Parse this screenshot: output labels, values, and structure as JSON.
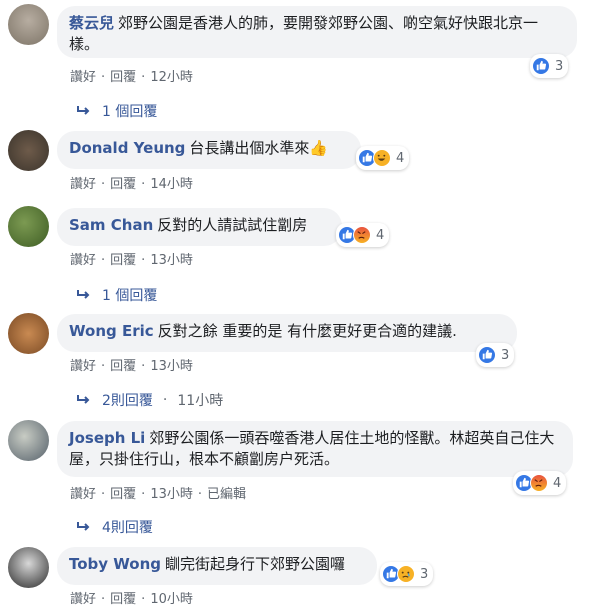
{
  "ui": {
    "like_label": "讚好",
    "reply_label": "回覆",
    "separator": "·"
  },
  "comments": [
    {
      "author": "蔡云兒",
      "text": "郊野公園是香港人的肺，要開發郊野公園、啲空氣好快跟北京一樣。",
      "time": "12小時",
      "reactions": [
        "like"
      ],
      "reaction_count": "3",
      "replies": {
        "text": "1 個回覆",
        "time": ""
      },
      "edited": ""
    },
    {
      "author": "Donald Yeung",
      "text": "台長講出個水準來👍",
      "time": "14小時",
      "reactions": [
        "like",
        "haha"
      ],
      "reaction_count": "4",
      "edited": ""
    },
    {
      "author": "Sam Chan",
      "text": "反對的人請試試住劏房",
      "time": "13小時",
      "reactions": [
        "like",
        "angry"
      ],
      "reaction_count": "4",
      "replies": {
        "text": "1 個回覆",
        "time": ""
      },
      "edited": ""
    },
    {
      "author": "Wong Eric",
      "text": "反對之餘 重要的是 有什麼更好更合適的建議.",
      "time": "13小時",
      "reactions": [
        "like"
      ],
      "reaction_count": "3",
      "replies": {
        "text": "2則回覆",
        "time": "11小時"
      },
      "edited": ""
    },
    {
      "author": "Joseph Li",
      "text": "郊野公園係一頭吞噬香港人居住土地的怪獸。林超英自己住大屋，只掛住行山，根本不顧劏房户死活。",
      "time": "13小時",
      "reactions": [
        "like",
        "angry"
      ],
      "reaction_count": "4",
      "replies": {
        "text": "4則回覆",
        "time": ""
      },
      "edited": "已編輯"
    },
    {
      "author": "Toby Wong",
      "text": "瞓完街起身行下郊野公園囉",
      "time": "10小時",
      "reactions": [
        "like",
        "sad"
      ],
      "reaction_count": "3",
      "edited": ""
    }
  ]
}
